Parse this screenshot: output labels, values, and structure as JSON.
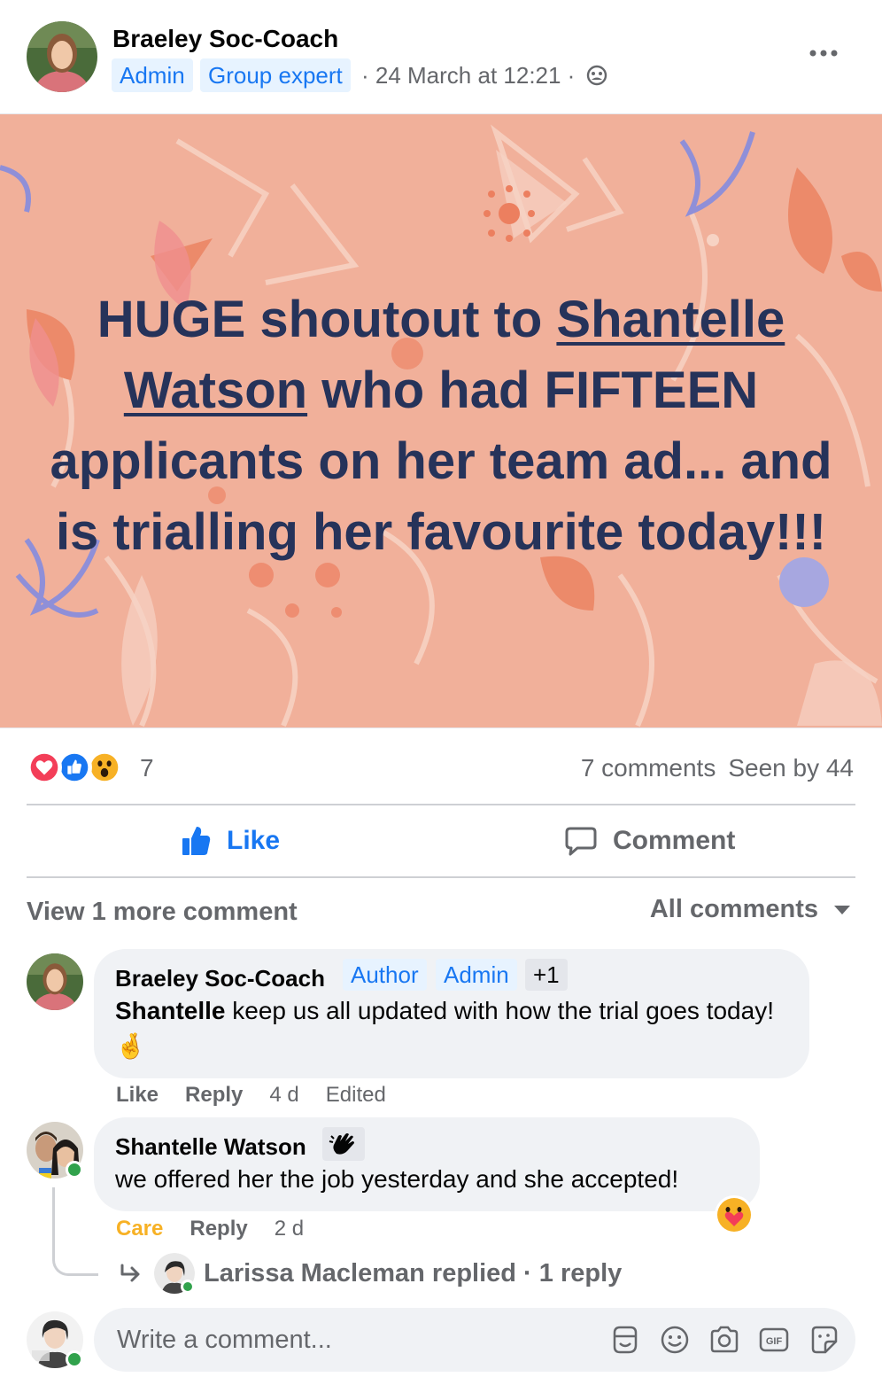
{
  "post": {
    "author": "Braeley Soc-Coach",
    "badges": [
      "Admin",
      "Group expert"
    ],
    "meta": "· 24 March at 12:21 ·",
    "text_before": "HUGE shoutout to ",
    "mention": "Shantelle Watson",
    "text_after": " who had FIFTEEN applicants on her team ad... and is trialling her favourite today!!!",
    "image_bg_color": "#f1b09a",
    "text_color": "#26335a"
  },
  "reactions": {
    "icons": [
      "love-icon",
      "like-icon",
      "wow-icon"
    ],
    "count": "7",
    "comments": "7 comments",
    "seen": "Seen by 44"
  },
  "actions": {
    "like": "Like",
    "comment": "Comment"
  },
  "comments_section": {
    "view_more": "View 1 more comment",
    "filter": "All comments",
    "comments": [
      {
        "author": "Braeley Soc-Coach",
        "badges": [
          "Author",
          "Admin",
          "+1"
        ],
        "mention": "Shantelle",
        "text": " keep us all updated with how the trial goes today! 🤞",
        "actions": [
          "Like",
          "Reply",
          "4 d",
          "Edited"
        ]
      },
      {
        "author": "Shantelle Watson",
        "text": "we offered her the job yesterday and she accepted!",
        "actions": [
          "Care",
          "Reply",
          "2 d"
        ],
        "reaction_icon": "care-icon"
      }
    ],
    "reply_summary": "Larissa Macleman replied · 1 reply"
  },
  "composer": {
    "placeholder": "Write a comment...",
    "tools": [
      "avatar-sticker-icon",
      "emoji-icon",
      "camera-icon",
      "gif-icon",
      "sticker-icon"
    ]
  },
  "colors": {
    "accent": "#1877f2",
    "secondary_text": "#65676b",
    "bubble": "#f0f2f5",
    "care": "#f7b125"
  }
}
